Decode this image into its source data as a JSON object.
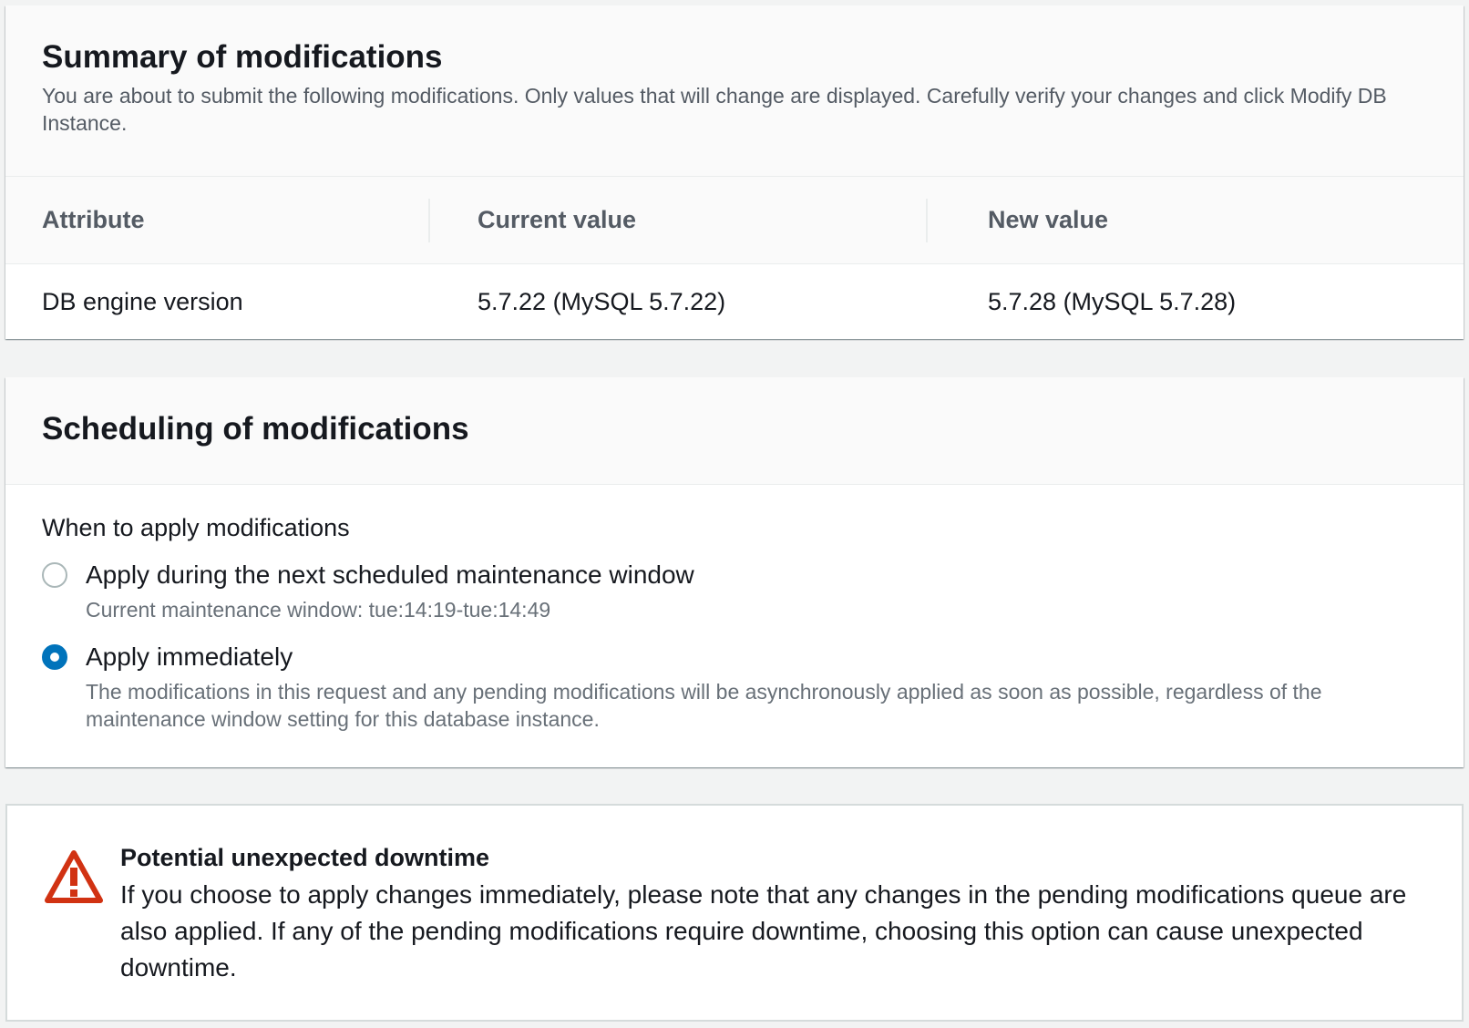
{
  "summary": {
    "title": "Summary of modifications",
    "description": "You are about to submit the following modifications. Only values that will change are displayed. Carefully verify your changes and click Modify DB Instance.",
    "columns": [
      "Attribute",
      "Current value",
      "New value"
    ],
    "rows": [
      {
        "attribute": "DB engine version",
        "current": "5.7.22 (MySQL 5.7.22)",
        "new": "5.7.28 (MySQL 5.7.28)"
      }
    ]
  },
  "scheduling": {
    "title": "Scheduling of modifications",
    "field_label": "When to apply modifications",
    "selected": "apply-immediately",
    "options": [
      {
        "id": "apply-next-window",
        "label": "Apply during the next scheduled maintenance window",
        "description": "Current maintenance window: tue:14:19-tue:14:49",
        "checked": false
      },
      {
        "id": "apply-immediately",
        "label": "Apply immediately",
        "description": "The modifications in this request and any pending modifications will be asynchronously applied as soon as possible, regardless of the maintenance window setting for this database instance.",
        "checked": true
      }
    ]
  },
  "warning": {
    "icon": "warning-triangle-icon",
    "icon_color": "#d13212",
    "title": "Potential unexpected downtime",
    "text": "If you choose to apply changes immediately, please note that any changes in the pending modifications queue are also applied. If any of the pending modifications require downtime, choosing this option can cause unexpected downtime."
  },
  "colors": {
    "accent": "#0073bb",
    "page_background": "#f2f3f3",
    "warning": "#d13212"
  }
}
